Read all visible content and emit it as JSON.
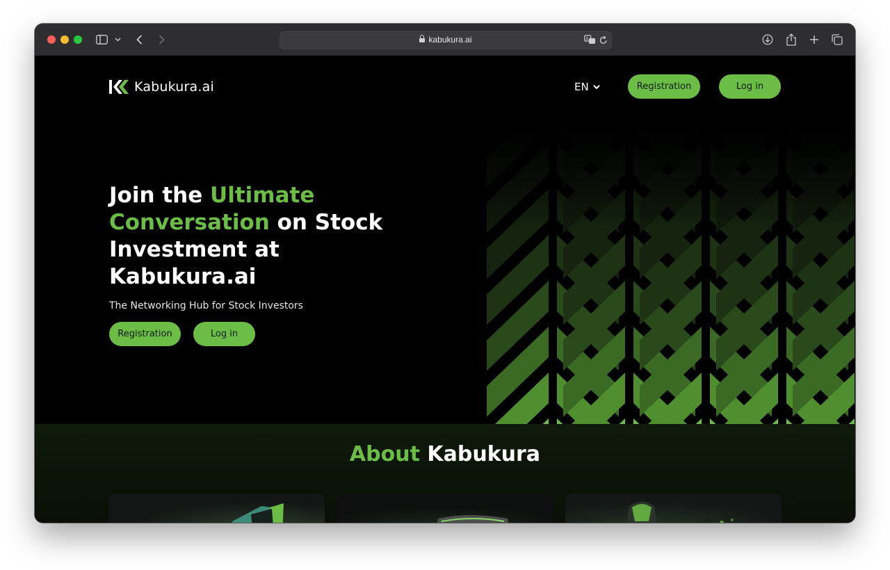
{
  "browser": {
    "url": "kabukura.ai"
  },
  "header": {
    "logo_text": "Kabukura.ai",
    "language": "EN",
    "registration_label": "Registration",
    "login_label": "Log in"
  },
  "hero": {
    "title_part1": "Join the ",
    "title_highlight": "Ultimate Conversation",
    "title_part2": " on Stock Investment at Kabukura.ai",
    "subtitle": "The Networking Hub for Stock Investors",
    "registration_label": "Registration",
    "login_label": "Log in"
  },
  "about": {
    "title_highlight": "About",
    "title_rest": " Kabukura"
  },
  "colors": {
    "accent": "#6cbd45",
    "background": "#000000"
  }
}
